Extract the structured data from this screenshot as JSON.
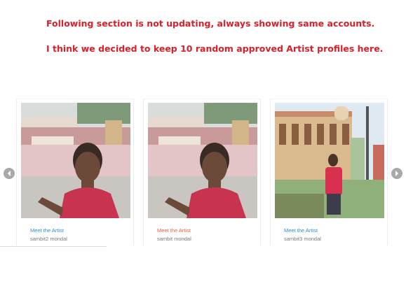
{
  "notes": {
    "line1": "Following section is not updating, always showing same accounts.",
    "line2": "I think we decided to keep 10 random approved Artist profiles here."
  },
  "carousel": {
    "prev_icon": "chevron-left-icon",
    "next_icon": "chevron-right-icon",
    "link_color": "#2f8bc9",
    "link_active_color": "#e9633f",
    "cards": [
      {
        "meet_label": "Meet the Artist",
        "name": "sambit2 mondal",
        "active": false
      },
      {
        "meet_label": "Meet the Artist",
        "name": "sambit mondal",
        "active": true
      },
      {
        "meet_label": "Meet the Artist",
        "name": "sambit3 mondal",
        "active": false
      }
    ]
  },
  "colors": {
    "note_text": "#d9202a",
    "arrow_bg": "#a9a9a9"
  }
}
